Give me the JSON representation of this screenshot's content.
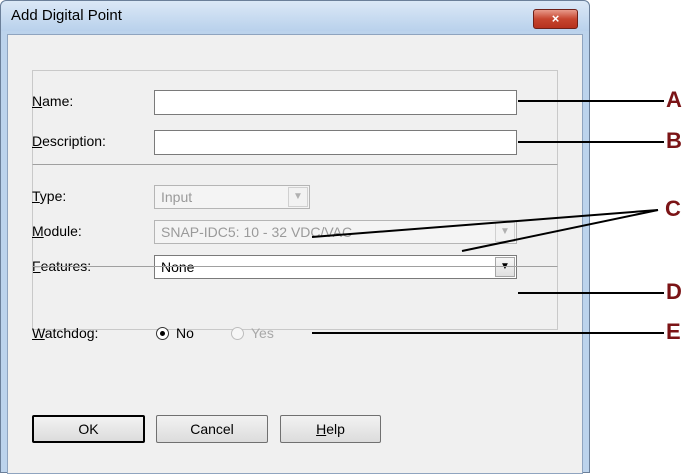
{
  "dialog": {
    "title": "Add Digital Point",
    "close_glyph": "×"
  },
  "fields": {
    "name_label_mnemonic": "N",
    "name_label_rest": "ame:",
    "name_value": "",
    "description_label_mnemonic": "D",
    "description_label_rest": "escription:",
    "description_value": "",
    "type_label_mnemonic": "T",
    "type_label_rest": "ype:",
    "type_value": "Input",
    "module_label_mnemonic": "M",
    "module_label_rest": "odule:",
    "module_value": "SNAP-IDC5: 10 - 32 VDC/VAC",
    "features_label_mnemonic": "F",
    "features_label_rest": "eatures:",
    "features_value": "None",
    "watchdog_label_mnemonic": "W",
    "watchdog_label_rest": "atchdog:",
    "watchdog_no": "No",
    "watchdog_yes": "Yes"
  },
  "buttons": {
    "ok": "OK",
    "cancel": "Cancel",
    "help_mnemonic": "H",
    "help_rest": "elp"
  },
  "callouts": {
    "a": "A",
    "b": "B",
    "c": "C",
    "d": "D",
    "e": "E",
    "color": "#7b1416"
  },
  "icons": {
    "dropdown": "chevron-down-icon",
    "close": "close-icon"
  }
}
